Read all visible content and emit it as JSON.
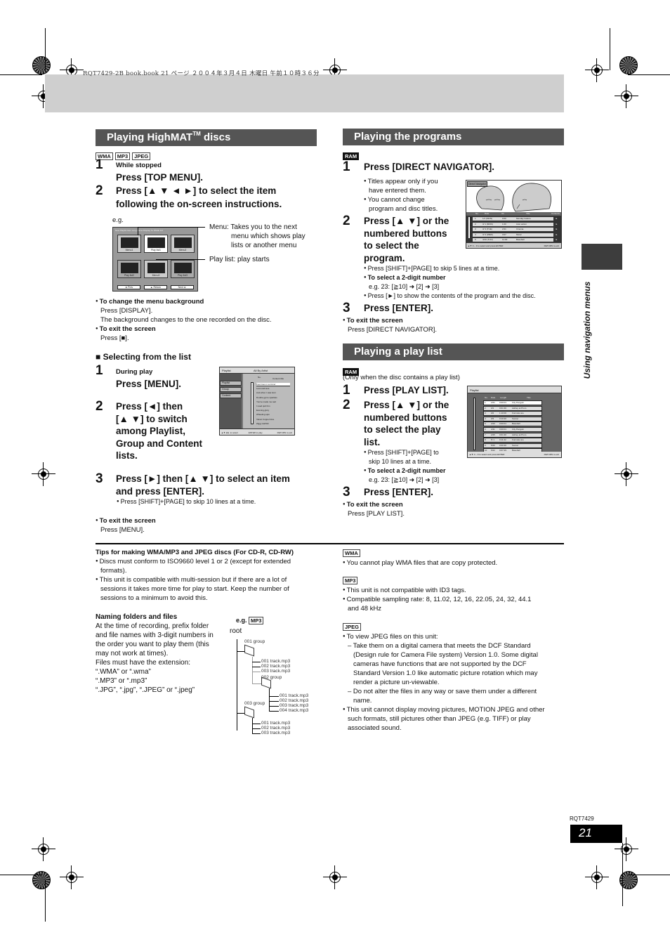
{
  "header": {
    "stamp": "RQT7429-2B book.book  21 ページ  ２００４年３月４日  木曜日  午前１０時３６分"
  },
  "side_tab": {
    "label": "Using navigation menus"
  },
  "footer": {
    "code": "RQT7429",
    "page_number": "21"
  },
  "highmat": {
    "title": "Playing HighMAT",
    "title_tm": "TM",
    "title_suffix": " discs",
    "tags": [
      "WMA",
      "MP3",
      "JPEG"
    ],
    "step1_pre": "While stopped",
    "step1": "Press [TOP MENU].",
    "step2_line1": "Press [▲ ▼ ◄ ►] to select the item",
    "step2_line2": "following the on-screen instructions.",
    "eg": "e.g.",
    "screen": {
      "title": "New Playlist Item Long Name Display Te   PAGE 1/2",
      "tiles": [
        "Menu1",
        "Play list1",
        "Menu2",
        "Play list2",
        "Menu3",
        "Play list3"
      ],
      "buttons": [
        "◄ Prev",
        "▲ Return",
        "Next ►"
      ]
    },
    "callout_menu_1": "Menu: Takes you to the next",
    "callout_menu_2": "menu which shows play",
    "callout_menu_3": "lists or another menu",
    "callout_playlist": "Play list: play starts",
    "note1_head": "To change the menu background",
    "note1_l1": "Press [DISPLAY].",
    "note1_l2": "The background changes to the one recorded on the disc.",
    "note2_head": "To exit the screen",
    "note2_l1": "Press [■].",
    "sub_head": "■ Selecting from the list",
    "s1_pre": "During play",
    "s1": "Press [MENU].",
    "s2": [
      "Press [◄] then",
      "[▲ ▼] to switch",
      "among Playlist,",
      "Group and Content",
      "lists."
    ],
    "s3_l1": "Press [►] then [▲ ▼] to select an item",
    "s3_l2": "and press [ENTER].",
    "s3_note": "Press [SHIFT]+[PAGE] to skip 10 lines at a time.",
    "exit_head": "To exit the screen",
    "exit_l1": "Press [MENU].",
    "list_screen": {
      "head_left": "Playlist",
      "head_right": "All By Artist",
      "tabs": [
        "Playlist",
        "Group",
        "Content"
      ],
      "col_no": "No.",
      "col_title": "Content title",
      "rows": [
        "Few lines in summer",
        "Less and less",
        "And when I was born",
        "Double gyme sparkles",
        "You've made me sad",
        "I used quit him",
        "Evening glory",
        "Wheeling spin",
        "Velvet Cuppermine",
        "Ziggy starfish"
      ],
      "foot_left": "▲▼◄► to select",
      "foot_mid": "ENTER to play",
      "foot_right": "RETURN to exit"
    }
  },
  "programs": {
    "title": "Playing the programs",
    "tag": "RAM",
    "step1": "Press [DIRECT NAVIGATOR].",
    "b1_l1": "Titles appear only if you",
    "b1_l2": "have entered them.",
    "b2_l1": "You cannot change",
    "b2_l2": "program and disc titles.",
    "step2": [
      "Press [▲ ▼] or the",
      "numbered buttons",
      "to select the",
      "program."
    ],
    "n1": "Press [SHIFT]+[PAGE] to skip 5 lines at a time.",
    "n2_head": "To select a 2-digit number",
    "n2_l1": "e.g. 23: [≧10] ➜   [2] ➜   [3]",
    "n3": "Press [►] to show the contents of the program and the disc.",
    "step3": "Press [ENTER].",
    "exit_head": "To exit the screen",
    "exit_l1": "Press [DIRECT NAVIGATOR].",
    "screen": {
      "label": "Direct Navigator",
      "cols": [
        "No.",
        "Date",
        "On",
        "Title",
        "Contents"
      ],
      "rows": [
        [
          "1",
          "1/1 (MON)",
          "0:00",
          "Monday feature"
        ],
        [
          "2",
          "3/ 1 (MON)",
          "1:00",
          "Auto action"
        ],
        [
          "3",
          "3/ 3 (TUE)",
          "2:01",
          "Cinema"
        ],
        [
          "4",
          "3/ 3 (WED)",
          "3:07",
          "Music"
        ],
        [
          "5",
          "4/10 (THU)",
          "11:00",
          "Baseball"
        ]
      ],
      "foot_left": "▲▼ 0 – 9 to select and press ENTER",
      "foot_right": "RETURN to exit"
    }
  },
  "playlist": {
    "title": "Playing a play list",
    "tag": "RAM",
    "note": "(Only when the disc contains a play list)",
    "step1": "Press [PLAY LIST].",
    "step2": [
      "Press [▲ ▼] or the",
      "numbered buttons",
      "to select the play",
      "list."
    ],
    "n1_l1": "Press [SHIFT]+[PAGE] to",
    "n1_l2": "skip 10 lines at a time.",
    "n2_head": "To select a 2-digit number",
    "n2_l1": "e.g. 23: [≧10] ➜   [2] ➜   [3]",
    "step3": "Press [ENTER].",
    "exit_head": "To exit the screen",
    "exit_l1": "Press [PLAY LIST].",
    "screen": {
      "label": "Playlist",
      "cols": [
        "No.",
        "Date",
        "Length",
        "Title"
      ],
      "rows": [
        [
          "1",
          "1/01",
          "0:00:01",
          "City Penguin"
        ],
        [
          "2",
          "3/1",
          "0:01:30",
          "Ashley at Prom"
        ],
        [
          "3",
          "3/2",
          "1:10:00",
          "Formula one"
        ],
        [
          "4",
          "3/3",
          "0:10:20",
          "Soccer"
        ],
        [
          "5",
          "4/10",
          "0:00:01",
          "Baseball"
        ],
        [
          "6",
          "4/11",
          "0:00:01",
          "City Penguin"
        ],
        [
          "7",
          "4/15",
          "0:01:30",
          "Ashley at Prom"
        ],
        [
          "8",
          "5/ 1",
          "0:11:22",
          "Formula one"
        ],
        [
          "9",
          "5/20",
          "0:00:30",
          "Soccer"
        ],
        [
          "10",
          "5/22",
          "0:07:29",
          "Baseball"
        ]
      ],
      "foot_left": "▲▼ 0 – 9 to select and press ENTER",
      "foot_right": "RETURN to exit"
    }
  },
  "tips": {
    "title": "Tips for making WMA/MP3 and JPEG discs (For CD-R, CD-RW)",
    "b1_l1": "Discs must conform to ISO9660 level 1 or 2 (except for extended",
    "b1_l2": "formats).",
    "b2_l1": "This unit is compatible with multi-session but if there are a lot of",
    "b2_l2": "sessions it takes more time for play to start. Keep the number of",
    "b2_l3": "sessions to a minimum to avoid this.",
    "naming_head": "Naming folders and files",
    "naming_lines": [
      "At the time of recording, prefix folder",
      "and file names with 3-digit numbers in",
      "the order you want to play them (this",
      "may not work at times).",
      "Files must have the extension:",
      "“.WMA” or “.wma”",
      "“.MP3” or “.mp3”",
      "“.JPG”, “.jpg”, “.JPEG” or “.jpeg”"
    ],
    "eg": "e.g.",
    "eg_tag": "MP3",
    "tree": {
      "root": "root",
      "g1": "001 group",
      "g1_files": [
        "001 track.mp3",
        "002 track.mp3",
        "003 track.mp3"
      ],
      "g2": "002 group",
      "g2_files": [
        "001 track.mp3",
        "002 track.mp3",
        "003 track.mp3",
        "004 track.mp3"
      ],
      "g3": "003 group",
      "g3_files": [
        "001 track.mp3",
        "002 track.mp3",
        "003 track.mp3"
      ]
    },
    "wma_tag": "WMA",
    "wma_b1": "You cannot play WMA files that are copy protected.",
    "mp3_tag": "MP3",
    "mp3_b1": "This unit is not compatible with ID3 tags.",
    "mp3_b2_l1": "Compatible sampling rate:  8, 11.02, 12, 16, 22.05, 24, 32, 44.1",
    "mp3_b2_l2": "and 48 kHz",
    "jpeg_tag": "JPEG",
    "jpeg_b1": "To view JPEG files on this unit:",
    "jpeg_d1": [
      "– Take them on a digital camera that meets the DCF Standard",
      "(Design rule for Camera File system) Version 1.0. Some digital",
      "cameras have functions that are not supported by the DCF",
      "Standard Version 1.0 like automatic picture rotation which may",
      "render a picture un-viewable."
    ],
    "jpeg_d2": [
      "– Do not alter the files in any way or save them under a different",
      "name."
    ],
    "jpeg_b2": [
      "This unit cannot display moving pictures, MOTION JPEG and other",
      "such formats, still pictures other than JPEG (e.g. TIFF) or play",
      "associated sound."
    ]
  }
}
